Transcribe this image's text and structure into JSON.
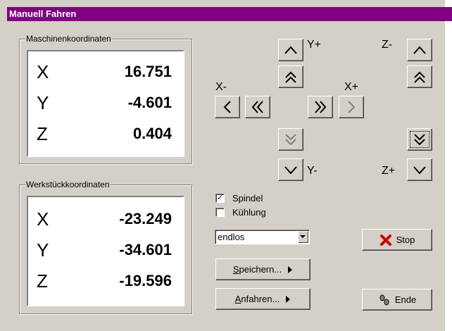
{
  "window": {
    "title": "Manuell Fahren"
  },
  "machine": {
    "title": "Maschinenkoordinaten",
    "rows": [
      {
        "axis": "X",
        "value": "16.751"
      },
      {
        "axis": "Y",
        "value": "-4.601"
      },
      {
        "axis": "Z",
        "value": "0.404"
      }
    ]
  },
  "workpiece": {
    "title": "Werkstückkoordinaten",
    "rows": [
      {
        "axis": "X",
        "value": "-23.249"
      },
      {
        "axis": "Y",
        "value": "-34.601"
      },
      {
        "axis": "Z",
        "value": "-19.596"
      }
    ]
  },
  "jog": {
    "y_plus": "Y+",
    "y_minus": "Y-",
    "x_minus": "X-",
    "x_plus": "X+",
    "z_minus": "Z-",
    "z_plus": "Z+"
  },
  "options": {
    "spindle": {
      "label": "Spindel",
      "checked": true
    },
    "cooling": {
      "label": "Kühlung",
      "checked": false
    }
  },
  "mode": {
    "value": "endlos"
  },
  "buttons": {
    "save": "Speichern...",
    "save_hotkey": "S",
    "approach": "Anfahren...",
    "approach_hotkey": "A",
    "stop": "Stop",
    "end": "Ende"
  },
  "colors": {
    "titlebar": "#800080",
    "face": "#d4d0c8",
    "stop_icon": "#cc0000"
  }
}
